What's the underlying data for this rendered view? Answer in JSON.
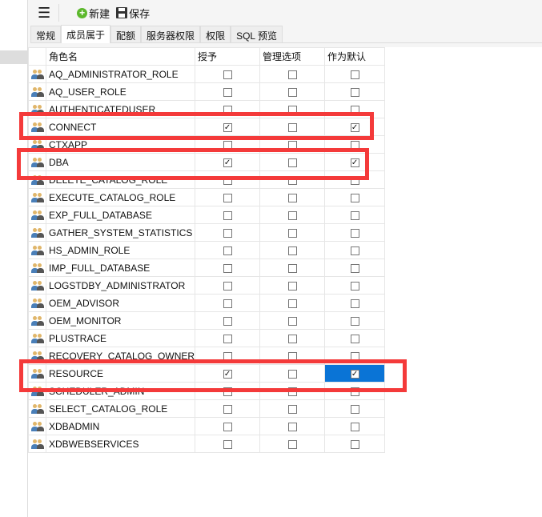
{
  "toolbar": {
    "menu_icon": "hamburger-icon",
    "new_label": "新建",
    "save_label": "保存"
  },
  "tabs": [
    "常规",
    "成员属于",
    "配额",
    "服务器权限",
    "权限",
    "SQL 预览"
  ],
  "active_tab": 1,
  "columns": {
    "name": "角色名",
    "grant": "授予",
    "admin": "管理选项",
    "default": "作为默认"
  },
  "rows": [
    {
      "name": "AQ_ADMINISTRATOR_ROLE",
      "grant": false,
      "admin": false,
      "default": false
    },
    {
      "name": "AQ_USER_ROLE",
      "grant": false,
      "admin": false,
      "default": false
    },
    {
      "name": "AUTHENTICATEDUSER",
      "grant": false,
      "admin": false,
      "default": false
    },
    {
      "name": "CONNECT",
      "grant": true,
      "admin": false,
      "default": true
    },
    {
      "name": "CTXAPP",
      "grant": false,
      "admin": false,
      "default": false
    },
    {
      "name": "DBA",
      "grant": true,
      "admin": false,
      "default": true
    },
    {
      "name": "DELETE_CATALOG_ROLE",
      "grant": false,
      "admin": false,
      "default": false
    },
    {
      "name": "EXECUTE_CATALOG_ROLE",
      "grant": false,
      "admin": false,
      "default": false
    },
    {
      "name": "EXP_FULL_DATABASE",
      "grant": false,
      "admin": false,
      "default": false
    },
    {
      "name": "GATHER_SYSTEM_STATISTICS",
      "grant": false,
      "admin": false,
      "default": false
    },
    {
      "name": "HS_ADMIN_ROLE",
      "grant": false,
      "admin": false,
      "default": false
    },
    {
      "name": "IMP_FULL_DATABASE",
      "grant": false,
      "admin": false,
      "default": false
    },
    {
      "name": "LOGSTDBY_ADMINISTRATOR",
      "grant": false,
      "admin": false,
      "default": false
    },
    {
      "name": "OEM_ADVISOR",
      "grant": false,
      "admin": false,
      "default": false
    },
    {
      "name": "OEM_MONITOR",
      "grant": false,
      "admin": false,
      "default": false
    },
    {
      "name": "PLUSTRACE",
      "grant": false,
      "admin": false,
      "default": false
    },
    {
      "name": "RECOVERY_CATALOG_OWNER",
      "grant": false,
      "admin": false,
      "default": false
    },
    {
      "name": "RESOURCE",
      "grant": true,
      "admin": false,
      "default": true,
      "selected_cell": "default"
    },
    {
      "name": "SCHEDULER_ADMIN",
      "grant": false,
      "admin": false,
      "default": false
    },
    {
      "name": "SELECT_CATALOG_ROLE",
      "grant": false,
      "admin": false,
      "default": false
    },
    {
      "name": "XDBADMIN",
      "grant": false,
      "admin": false,
      "default": false
    },
    {
      "name": "XDBWEBSERVICES",
      "grant": false,
      "admin": false,
      "default": false
    }
  ],
  "highlight_color": "#f43a3a",
  "selection_color": "#0a74d6"
}
